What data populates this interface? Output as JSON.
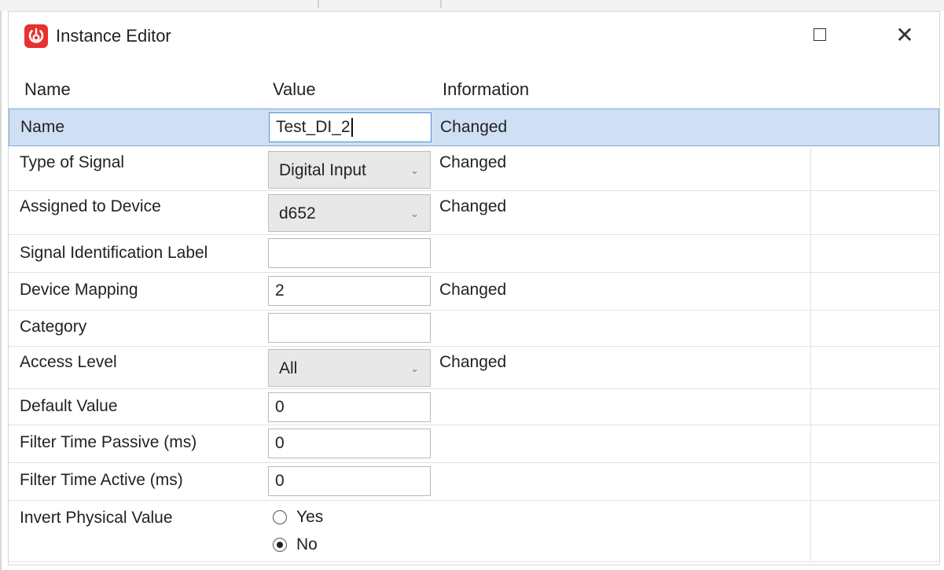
{
  "window": {
    "title": "Instance Editor",
    "close_glyph": "✕"
  },
  "icons": {
    "app": "signal-app-icon",
    "maximize": "maximize-icon",
    "close": "close-icon",
    "dropdown": "chevron-down-icon"
  },
  "colors": {
    "selection": "#cfe0f4",
    "focus_border": "#4a90d9",
    "app_icon": "#e8322f"
  },
  "columns": {
    "name": "Name",
    "value": "Value",
    "info": "Information"
  },
  "rows": {
    "name": {
      "label": "Name",
      "value": "Test_DI_2",
      "info": "Changed"
    },
    "signal_type": {
      "label": "Type of Signal",
      "value": "Digital Input",
      "info": "Changed"
    },
    "device": {
      "label": "Assigned to Device",
      "value": "d652",
      "info": "Changed"
    },
    "ident_label": {
      "label": "Signal Identification Label",
      "value": "",
      "info": ""
    },
    "mapping": {
      "label": "Device Mapping",
      "value": "2",
      "info": "Changed"
    },
    "category": {
      "label": "Category",
      "value": "",
      "info": ""
    },
    "access_level": {
      "label": "Access Level",
      "value": "All",
      "info": "Changed"
    },
    "default_value": {
      "label": "Default Value",
      "value": "0",
      "info": ""
    },
    "filter_passive": {
      "label": "Filter Time Passive (ms)",
      "value": "0",
      "info": ""
    },
    "filter_active": {
      "label": "Filter Time Active (ms)",
      "value": "0",
      "info": ""
    },
    "invert": {
      "label": "Invert Physical Value",
      "option_yes": "Yes",
      "option_no": "No",
      "selected": "No",
      "info": ""
    }
  },
  "chevron_glyph": "⌄"
}
